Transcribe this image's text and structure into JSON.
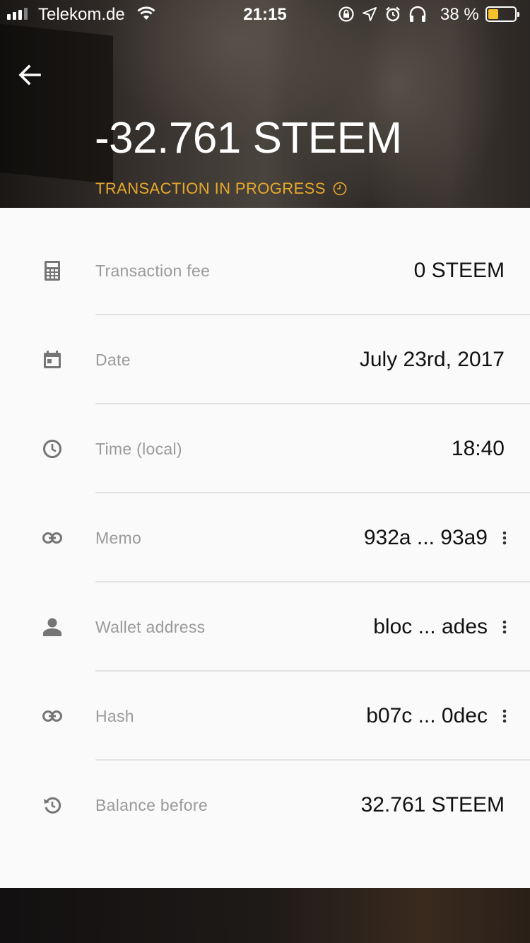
{
  "status_bar": {
    "carrier": "Telekom.de",
    "time": "21:15",
    "battery_percent": "38 %",
    "battery_level": 0.38
  },
  "header": {
    "amount": "-32.761 STEEM",
    "status": "TRANSACTION IN PROGRESS"
  },
  "details": [
    {
      "icon": "calculator-icon",
      "label": "Transaction fee",
      "value": "0 STEEM",
      "more": false
    },
    {
      "icon": "calendar-icon",
      "label": "Date",
      "value": "July 23rd, 2017",
      "more": false
    },
    {
      "icon": "clock-icon",
      "label": "Time (local)",
      "value": "18:40",
      "more": false
    },
    {
      "icon": "link-icon",
      "label": "Memo",
      "value": "932a ... 93a9",
      "more": true
    },
    {
      "icon": "person-icon",
      "label": "Wallet address",
      "value": "bloc ... ades",
      "more": true
    },
    {
      "icon": "link-icon",
      "label": "Hash",
      "value": "b07c ... 0dec",
      "more": true
    },
    {
      "icon": "history-icon",
      "label": "Balance before",
      "value": "32.761 STEEM",
      "more": false
    }
  ],
  "colors": {
    "accent": "#e8a92a",
    "label": "#9a9a9a",
    "value": "#111111",
    "sheet": "#fafafa"
  }
}
